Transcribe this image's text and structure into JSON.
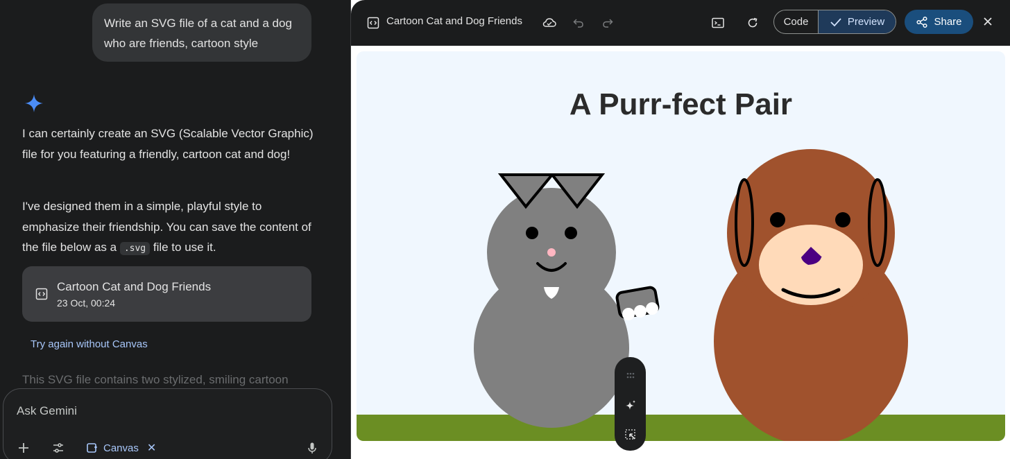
{
  "chat": {
    "user_prompt": "Write an SVG file of a cat and a dog who are friends, cartoon style",
    "response_p1": "I can certainly create an SVG (Scalable Vector Graphic) file for you featuring a friendly, cartoon cat and dog!",
    "response_p2_pre": "I've designed them in a simple, playful style to emphasize their friendship. You can save the content of the file below as a ",
    "response_p2_code": ".svg",
    "response_p2_post": " file to use it.",
    "canvas_card": {
      "title": "Cartoon Cat and Dog Friends",
      "date": "23 Oct, 00:24"
    },
    "try_again": "Try again without Canvas",
    "trailing_text": "This SVG file contains two stylized, smiling cartoon",
    "input_placeholder": "Ask Gemini",
    "canvas_chip": "Canvas"
  },
  "panel": {
    "title": "Cartoon Cat and Dog Friends",
    "code_label": "Code",
    "preview_label": "Preview",
    "share_label": "Share",
    "scene_title": "A Purr-fect Pair"
  },
  "colors": {
    "cat": "#808080",
    "dog": "#a0522d",
    "muzzle": "#ffdab9",
    "nose": "#4b0082",
    "grass": "#6b8e23",
    "sky": "#f0f7fe",
    "accent": "#a8c7fa"
  },
  "icons": [
    "spark-icon",
    "code-doc-icon",
    "cloud-icon",
    "undo-icon",
    "redo-icon",
    "terminal-icon",
    "refresh-icon",
    "check-icon",
    "share-icon",
    "close-icon",
    "plus-icon",
    "tools-icon",
    "canvas-icon",
    "mic-icon",
    "drag-icon",
    "magic-icon",
    "select-icon"
  ]
}
